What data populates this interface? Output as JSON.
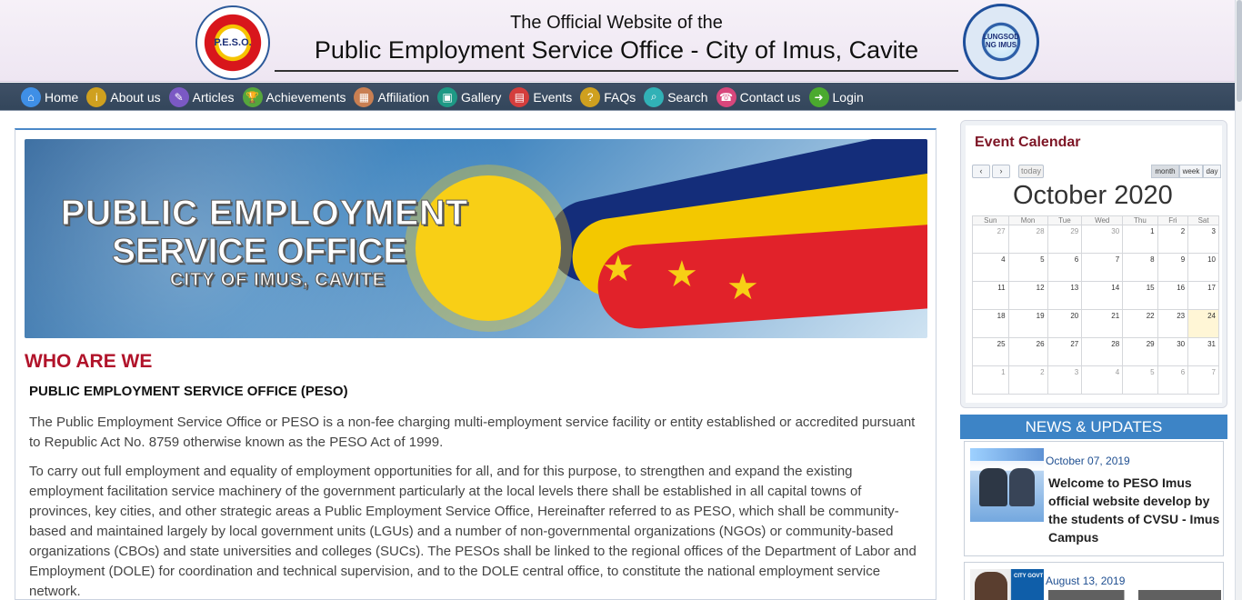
{
  "site": {
    "title_small": "The Official Website of the",
    "title_large": "Public Employment Service Office - City of Imus, Cavite"
  },
  "nav": {
    "items": [
      {
        "label": "Home",
        "icon": "home-icon",
        "color": "#3f8fe6"
      },
      {
        "label": "About us",
        "icon": "info-icon",
        "color": "#cfa01f"
      },
      {
        "label": "Articles",
        "icon": "pen-icon",
        "color": "#7b59c4"
      },
      {
        "label": "Achievements",
        "icon": "trophy-icon",
        "color": "#56a63c"
      },
      {
        "label": "Affiliation",
        "icon": "building-icon",
        "color": "#c97f52"
      },
      {
        "label": "Gallery",
        "icon": "photo-icon",
        "color": "#1e9985"
      },
      {
        "label": "Events",
        "icon": "calendar-icon",
        "color": "#d43e3d"
      },
      {
        "label": "FAQs",
        "icon": "question-icon",
        "color": "#cfa01f"
      },
      {
        "label": "Search",
        "icon": "search-icon",
        "color": "#31b1b6"
      },
      {
        "label": "Contact us",
        "icon": "phone-icon",
        "color": "#d8477c"
      },
      {
        "label": "Login",
        "icon": "login-icon",
        "color": "#4baa2f"
      }
    ]
  },
  "banner": {
    "line1": "PUBLIC EMPLOYMENT",
    "line2": "SERVICE OFFICE",
    "line3": "CITY OF IMUS, CAVITE"
  },
  "main": {
    "section_title": "WHO ARE WE",
    "lead": "PUBLIC EMPLOYMENT SERVICE OFFICE (PESO)",
    "para1": "The Public Employment Service Office or PESO is a non-fee charging multi-employment service facility or entity established or accredited pursuant to Republic Act No. 8759 otherwise known as the PESO Act of 1999.",
    "para2": "To carry out full employment and equality of employment opportunities for all, and for this purpose, to strengthen and expand the existing employment facilitation service machinery of the government particularly at the local levels there shall be established in all capital towns of provinces, key cities, and other strategic areas a Public Employment Service Office, Hereinafter referred to as PESO, which shall be community-based and maintained largely by local government units (LGUs) and a number of non-governmental organizations (NGOs) or community-based organizations (CBOs) and state universities and colleges (SUCs). The PESOs shall be linked to the regional offices of the Department of Labor and Employment (DOLE) for coordination and technical supervision, and to the DOLE central office, to constitute the national employment service network."
  },
  "calendar": {
    "title": "Event Calendar",
    "today_label": "today",
    "month_label": "month",
    "week_label": "week",
    "day_label": "day",
    "month_title": "October 2020",
    "weekdays": [
      "Sun",
      "Mon",
      "Tue",
      "Wed",
      "Thu",
      "Fri",
      "Sat"
    ],
    "weeks": [
      [
        "27",
        "28",
        "29",
        "30",
        "1",
        "2",
        "3"
      ],
      [
        "4",
        "5",
        "6",
        "7",
        "8",
        "9",
        "10"
      ],
      [
        "11",
        "12",
        "13",
        "14",
        "15",
        "16",
        "17"
      ],
      [
        "18",
        "19",
        "20",
        "21",
        "22",
        "23",
        "24"
      ],
      [
        "25",
        "26",
        "27",
        "28",
        "29",
        "30",
        "31"
      ],
      [
        "1",
        "2",
        "3",
        "4",
        "5",
        "6",
        "7"
      ]
    ]
  },
  "news": {
    "title": "NEWS & UPDATES",
    "items": [
      {
        "date": "October 07, 2019",
        "headline": "Welcome to PESO Imus official website develop by the students of CVSU - Imus Campus"
      },
      {
        "date": "August 13, 2019",
        "headline": ""
      }
    ]
  },
  "logos": {
    "left_text": "P.E.S.O.",
    "right_text": "LUNGSOD NG IMUS"
  }
}
